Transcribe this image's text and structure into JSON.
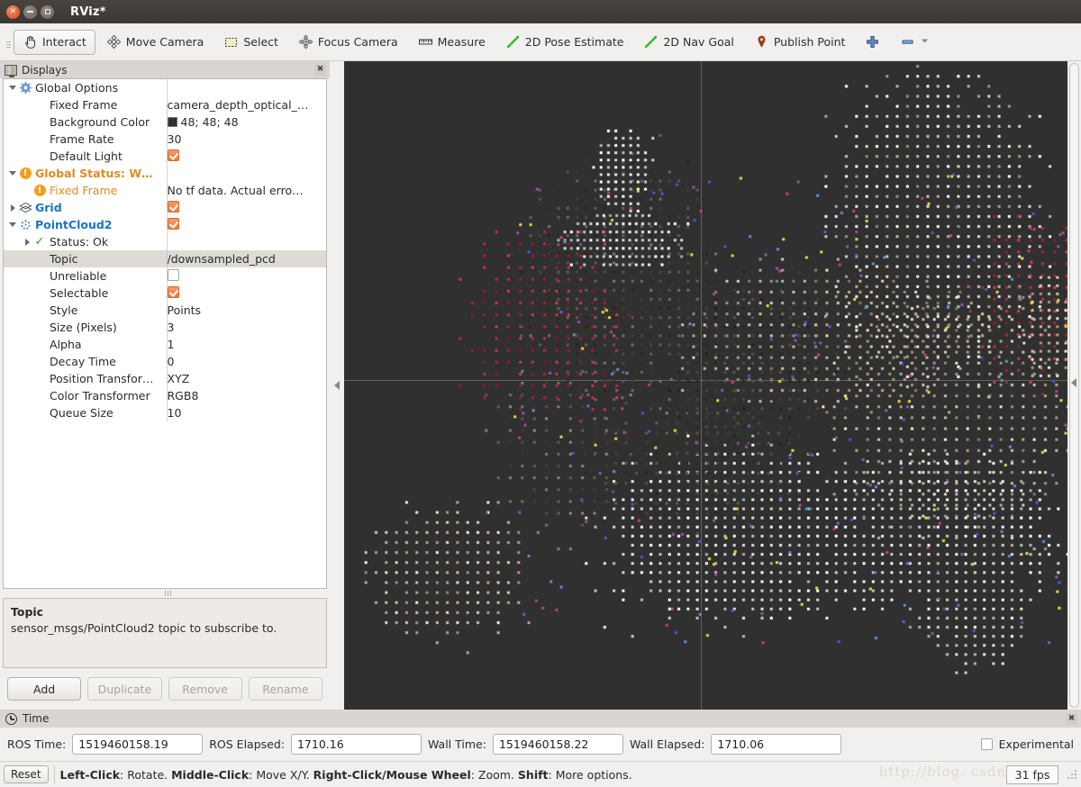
{
  "window": {
    "title": "RViz*",
    "buttons": [
      "close",
      "minimize",
      "maximize"
    ]
  },
  "toolbar": {
    "items": [
      {
        "label": "Interact",
        "icon": "hand-cursor-icon",
        "active": true
      },
      {
        "label": "Move Camera",
        "icon": "move-camera-icon",
        "active": false
      },
      {
        "label": "Select",
        "icon": "select-rectangle-icon",
        "active": false
      },
      {
        "label": "Focus Camera",
        "icon": "focus-camera-icon",
        "active": false
      },
      {
        "label": "Measure",
        "icon": "ruler-icon",
        "active": false
      },
      {
        "label": "2D Pose Estimate",
        "icon": "green-arrow-icon",
        "active": false
      },
      {
        "label": "2D Nav Goal",
        "icon": "green-arrow-icon",
        "active": false
      },
      {
        "label": "Publish Point",
        "icon": "map-pin-icon",
        "active": false
      }
    ],
    "add_tool_label": "+",
    "remove_tool_label": "–"
  },
  "displays": {
    "panel_title": "Displays",
    "close_label": "✖",
    "rows": [
      {
        "indent": 0,
        "twisty": "down",
        "icon": "gear-icon",
        "name": "Global Options",
        "value": "",
        "value_type": "text",
        "style": "plain",
        "selected": false
      },
      {
        "indent": 1,
        "twisty": "none",
        "icon": "none",
        "name": "Fixed Frame",
        "value": "camera_depth_optical_…",
        "value_type": "text",
        "style": "plain",
        "selected": false
      },
      {
        "indent": 1,
        "twisty": "none",
        "icon": "none",
        "name": "Background Color",
        "value": "48; 48; 48",
        "value_type": "color",
        "style": "plain",
        "selected": false
      },
      {
        "indent": 1,
        "twisty": "none",
        "icon": "none",
        "name": "Frame Rate",
        "value": "30",
        "value_type": "text",
        "style": "plain",
        "selected": false
      },
      {
        "indent": 1,
        "twisty": "none",
        "icon": "none",
        "name": "Default Light",
        "value": "",
        "value_type": "checked",
        "style": "plain",
        "selected": false
      },
      {
        "indent": 0,
        "twisty": "down",
        "icon": "warning-icon",
        "name": "Global Status: W…",
        "value": "",
        "value_type": "text",
        "style": "warn",
        "selected": false
      },
      {
        "indent": 1,
        "twisty": "none",
        "icon": "warning-icon",
        "name": "Fixed Frame",
        "value": "No tf data.  Actual erro…",
        "value_type": "text",
        "style": "warnplain",
        "selected": false
      },
      {
        "indent": 0,
        "twisty": "right",
        "icon": "grid-icon",
        "name": "Grid",
        "value": "",
        "value_type": "checked",
        "style": "link",
        "selected": false
      },
      {
        "indent": 0,
        "twisty": "down",
        "icon": "pointcloud-icon",
        "name": "PointCloud2",
        "value": "",
        "value_type": "checked",
        "style": "link",
        "selected": false
      },
      {
        "indent": 1,
        "twisty": "right",
        "icon": "ok-check-icon",
        "name": "Status: Ok",
        "value": "",
        "value_type": "text",
        "style": "plain",
        "selected": false
      },
      {
        "indent": 1,
        "twisty": "none",
        "icon": "none",
        "name": "Topic",
        "value": "/downsampled_pcd",
        "value_type": "text",
        "style": "plain",
        "selected": true
      },
      {
        "indent": 1,
        "twisty": "none",
        "icon": "none",
        "name": "Unreliable",
        "value": "",
        "value_type": "unchecked",
        "style": "plain",
        "selected": false
      },
      {
        "indent": 1,
        "twisty": "none",
        "icon": "none",
        "name": "Selectable",
        "value": "",
        "value_type": "checked",
        "style": "plain",
        "selected": false
      },
      {
        "indent": 1,
        "twisty": "none",
        "icon": "none",
        "name": "Style",
        "value": "Points",
        "value_type": "text",
        "style": "plain",
        "selected": false
      },
      {
        "indent": 1,
        "twisty": "none",
        "icon": "none",
        "name": "Size (Pixels)",
        "value": "3",
        "value_type": "text",
        "style": "plain",
        "selected": false
      },
      {
        "indent": 1,
        "twisty": "none",
        "icon": "none",
        "name": "Alpha",
        "value": "1",
        "value_type": "text",
        "style": "plain",
        "selected": false
      },
      {
        "indent": 1,
        "twisty": "none",
        "icon": "none",
        "name": "Decay Time",
        "value": "0",
        "value_type": "text",
        "style": "plain",
        "selected": false
      },
      {
        "indent": 1,
        "twisty": "none",
        "icon": "none",
        "name": "Position Transfor…",
        "value": "XYZ",
        "value_type": "text",
        "style": "plain",
        "selected": false
      },
      {
        "indent": 1,
        "twisty": "none",
        "icon": "none",
        "name": "Color Transformer",
        "value": "RGB8",
        "value_type": "text",
        "style": "plain",
        "selected": false
      },
      {
        "indent": 1,
        "twisty": "none",
        "icon": "none",
        "name": "Queue Size",
        "value": "10",
        "value_type": "text",
        "style": "plain",
        "selected": false
      }
    ],
    "description": {
      "title": "Topic",
      "text": "sensor_msgs/PointCloud2 topic to subscribe to."
    },
    "buttons": [
      {
        "label": "Add",
        "enabled": true
      },
      {
        "label": "Duplicate",
        "enabled": false
      },
      {
        "label": "Remove",
        "enabled": false
      },
      {
        "label": "Rename",
        "enabled": false
      }
    ]
  },
  "view3d": {
    "background_color": "#303030",
    "grid_color": "#a0a0a0"
  },
  "time_panel": {
    "panel_title": "Time",
    "close_label": "✖",
    "fields": [
      {
        "label": "ROS Time:",
        "value": "1519460158.19"
      },
      {
        "label": "ROS Elapsed:",
        "value": "1710.16"
      },
      {
        "label": "Wall Time:",
        "value": "1519460158.22"
      },
      {
        "label": "Wall Elapsed:",
        "value": "1710.06"
      }
    ],
    "experimental_label": "Experimental",
    "experimental_checked": false
  },
  "statusbar": {
    "reset_label": "Reset",
    "hint_parts": [
      {
        "text": "Left-Click",
        "bold": true
      },
      {
        "text": ": Rotate. ",
        "bold": false
      },
      {
        "text": "Middle-Click",
        "bold": true
      },
      {
        "text": ": Move X/Y. ",
        "bold": false
      },
      {
        "text": "Right-Click/Mouse Wheel",
        "bold": true
      },
      {
        "text": ": Zoom. ",
        "bold": false
      },
      {
        "text": "Shift",
        "bold": true
      },
      {
        "text": ": More options.",
        "bold": false
      }
    ],
    "watermark": "http://blog. csdn. net/w",
    "fps": "31 fps"
  }
}
